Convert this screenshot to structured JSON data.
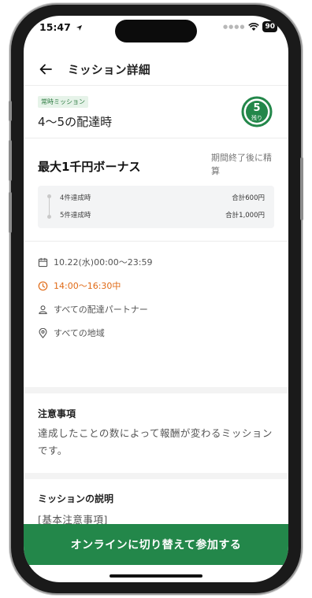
{
  "status_bar": {
    "time": "15:47",
    "battery": "90"
  },
  "header": {
    "title": "ミッション詳細"
  },
  "mission": {
    "tag": "常時ミッション",
    "name": "4〜5の配達時",
    "remaining_count": "5",
    "remaining_label": "残り",
    "remaining_fraction": 1.0
  },
  "bonus": {
    "title": "最大1千円ボーナス",
    "note": "期間終了後に精算",
    "tiers": [
      {
        "label": "4件達成時",
        "value": "合計600円"
      },
      {
        "label": "5件達成時",
        "value": "合計1,000円"
      }
    ]
  },
  "details": {
    "date": "10.22(水)00:00〜23:59",
    "hours": "14:00〜16:30中",
    "partners": "すべての配達パートナー",
    "area": "すべての地域"
  },
  "notice": {
    "title": "注意事項",
    "body": "達成したことの数によって報酬が変わるミッションです。"
  },
  "description": {
    "title": "ミッションの説明",
    "body": "[基本注意事項]"
  },
  "cta": {
    "label": "オンラインに切り替えて参加する"
  },
  "colors": {
    "brand": "#23874a",
    "accent_orange": "#e06a16",
    "tag_bg": "#e6f3e9"
  },
  "icons": [
    "back-arrow-icon",
    "calendar-icon",
    "clock-icon",
    "person-icon",
    "location-pin-icon",
    "wifi-icon",
    "location-arrow-icon"
  ]
}
